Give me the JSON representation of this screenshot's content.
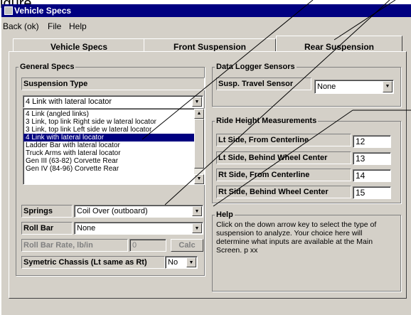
{
  "window": {
    "title": "Vehicle Specs",
    "top_fragment": "igure"
  },
  "menu": [
    "Back (ok)",
    "File",
    "Help"
  ],
  "tabs": [
    "Vehicle Specs",
    "Front Suspension",
    "Rear Suspension"
  ],
  "general": {
    "title": "General Specs",
    "susp_type_label": "Suspension Type",
    "susp_type_value": "4 Link with lateral locator",
    "options": [
      "4 Link (angled links)",
      "3 Link, top link Right side w lateral locator",
      "3 Link, top link Left side w lateral locator",
      "4 Link with lateral locator",
      "Ladder Bar with lateral locator",
      "Truck Arms with lateral locator",
      "Gen III (63-82) Corvette Rear",
      "Gen IV (84-96) Corvette Rear"
    ],
    "springs_label": "Springs",
    "springs_value": "Coil Over (outboard)",
    "rollbar_label": "Roll Bar",
    "rollbar_value": "None",
    "rollbar_rate_label": "Roll Bar Rate, lb/in",
    "rollbar_rate_value": "0",
    "calc_label": "Calc",
    "symetric_label": "Symetric Chassis (Lt same as Rt)",
    "symetric_value": "No"
  },
  "logger": {
    "title": "Data Logger Sensors",
    "sensor_label": "Susp. Travel Sensor",
    "sensor_value": "None"
  },
  "ride": {
    "title": "Ride Height Measurements",
    "rows": [
      {
        "label": "Lt Side, From Centerline",
        "value": "12"
      },
      {
        "label": "Lt Side, Behind Wheel Center",
        "value": "13"
      },
      {
        "label": "Rt Side, From Centerline",
        "value": "14"
      },
      {
        "label": "Rt Side, Behind Wheel Center",
        "value": "15"
      }
    ]
  },
  "help": {
    "title": "Help",
    "lines": [
      "Click on the down arrow key to select the type of",
      "suspension to analyze.  Your choice here will",
      "determine what inputs are available at the Main",
      "Screen.  p xx"
    ]
  }
}
